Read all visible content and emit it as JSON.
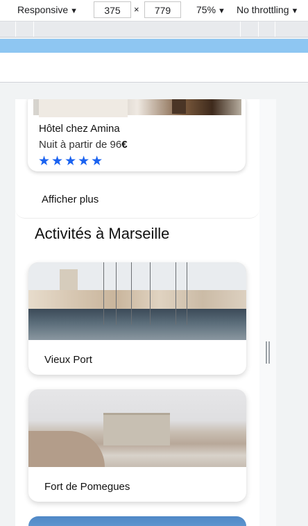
{
  "devtools": {
    "device": "Responsive",
    "width": "375",
    "times": "×",
    "height": "779",
    "zoom": "75%",
    "throttling": "No throttling",
    "dropdown_glyph": "▼"
  },
  "page": {
    "hotel": {
      "name": "Hôtel chez Amina",
      "price_prefix": "Nuit à partir de 96",
      "price_currency": "€",
      "stars": "★★★★★",
      "rating": 5
    },
    "show_more_label": "Afficher plus",
    "section_title": "Activités à Marseille",
    "activities": [
      {
        "label": "Vieux Port",
        "image": "harbor-photo"
      },
      {
        "label": "Fort de Pomegues",
        "image": "fort-photo"
      }
    ]
  },
  "colors": {
    "star": "#1a62f0",
    "media_query_bar": "#8ec6f2"
  }
}
